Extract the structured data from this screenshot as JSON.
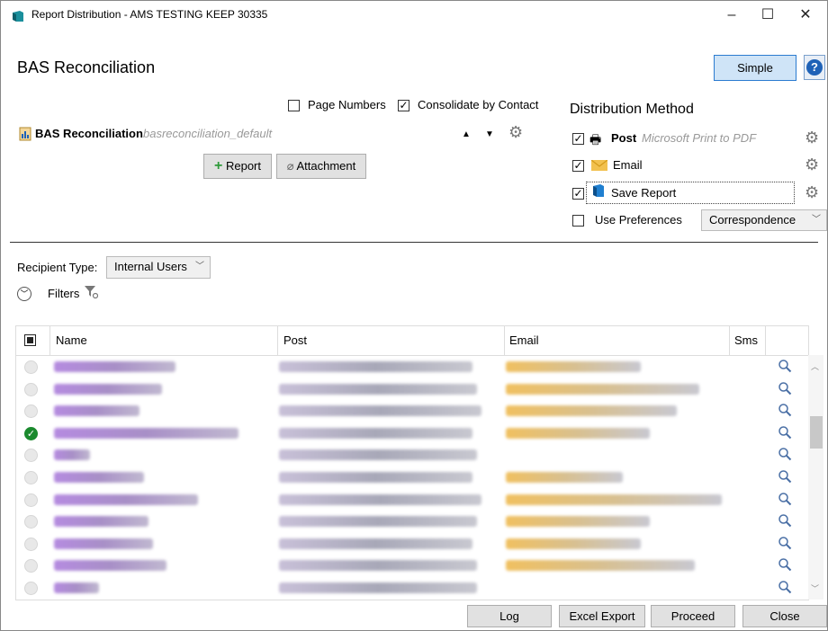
{
  "window": {
    "title": "Report Distribution - AMS TESTING KEEP 30335",
    "controls": {
      "minimize": "–",
      "maximize": "☐",
      "close": "✕"
    }
  },
  "header": {
    "title": "BAS Reconciliation",
    "simple_label": "Simple",
    "help_label": "?"
  },
  "options": {
    "page_numbers_label": "Page Numbers",
    "page_numbers_checked": false,
    "consolidate_label": "Consolidate by Contact",
    "consolidate_checked": true
  },
  "report": {
    "name": "BAS Reconciliation",
    "template": "basreconciliation_default",
    "add_report_label": "Report",
    "attachment_label": "Attachment"
  },
  "distribution": {
    "heading": "Distribution Method",
    "post_label": "Post",
    "post_printer": "Microsoft Print to PDF",
    "post_checked": true,
    "email_label": "Email",
    "email_checked": true,
    "save_label": "Save Report",
    "save_checked": true,
    "use_prefs_label": "Use Preferences",
    "use_prefs_checked": false,
    "prefs_value": "Correspondence"
  },
  "recipients": {
    "type_label": "Recipient Type:",
    "type_value": "Internal Users",
    "filters_label": "Filters"
  },
  "grid": {
    "columns": [
      "Name",
      "Post",
      "Email",
      "Sms"
    ],
    "selected_row": 3,
    "row_count": 11
  },
  "footer": {
    "log": "Log",
    "excel": "Excel Export",
    "proceed": "Proceed",
    "close": "Close"
  },
  "colors": {
    "accent": "#2b7bd0",
    "check_green": "#1b8a2e"
  }
}
